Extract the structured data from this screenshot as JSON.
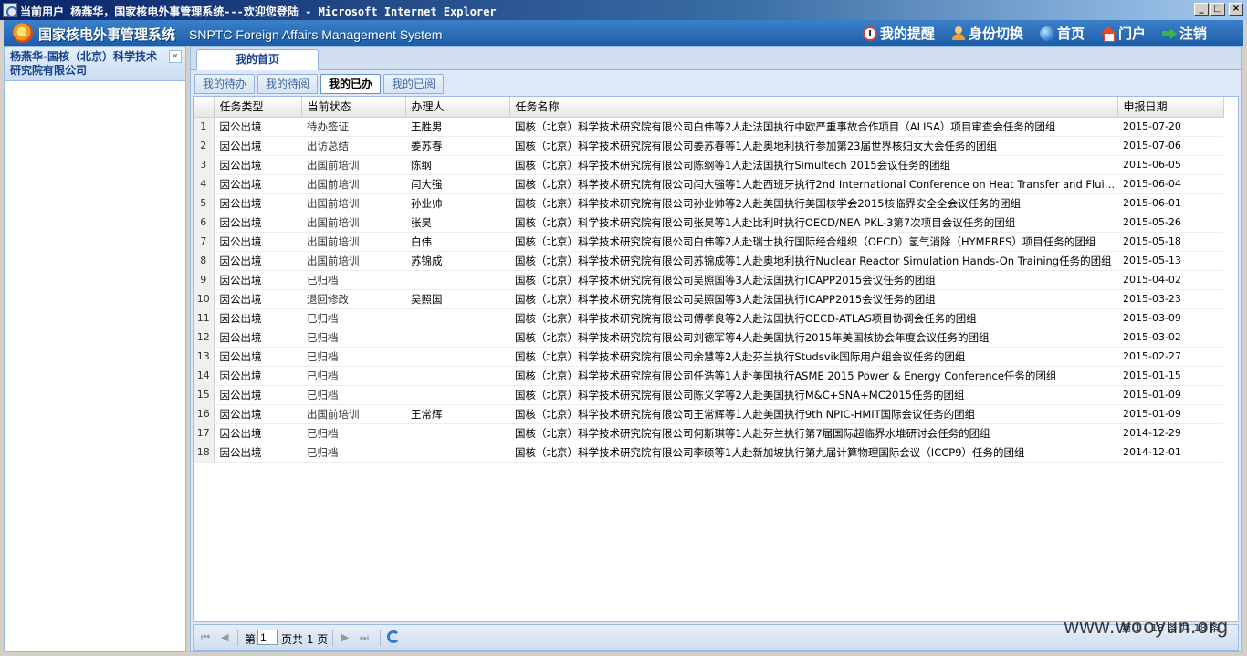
{
  "window": {
    "title": "当前用户 杨燕华，国家核电外事管理系统---欢迎您登陆 - Microsoft Internet Explorer"
  },
  "header": {
    "system_name_cn": "国家核电外事管理系统",
    "system_name_en": "SNPTC Foreign Affairs Management System",
    "nav": [
      {
        "label": "我的提醒",
        "icon": "clock-icon"
      },
      {
        "label": "身份切换",
        "icon": "user-icon"
      },
      {
        "label": "首页",
        "icon": "globe-icon"
      },
      {
        "label": "门户",
        "icon": "house-icon"
      },
      {
        "label": "注销",
        "icon": "logout-icon"
      }
    ]
  },
  "sidebar": {
    "user": "杨燕华-国核（北京）科学技术研究院有限公司",
    "collapse_glyph": "«"
  },
  "main": {
    "tab": "我的首页",
    "subtabs": [
      {
        "label": "我的待办",
        "active": false
      },
      {
        "label": "我的待阅",
        "active": false
      },
      {
        "label": "我的已办",
        "active": true
      },
      {
        "label": "我的已阅",
        "active": false
      }
    ],
    "columns": [
      "任务类型",
      "当前状态",
      "办理人",
      "任务名称",
      "申报日期"
    ],
    "rows": [
      {
        "n": "1",
        "type": "因公出境",
        "status": "待办签证",
        "handler": "王胜男",
        "name": "国核（北京）科学技术研究院有限公司白伟等2人赴法国执行中欧严重事故合作项目（ALISA）项目审查会任务的团组",
        "date": "2015-07-20"
      },
      {
        "n": "2",
        "type": "因公出境",
        "status": "出访总结",
        "handler": "姜苏春",
        "name": "国核（北京）科学技术研究院有限公司姜苏春等1人赴奥地利执行参加第23届世界核妇女大会任务的团组",
        "date": "2015-07-06"
      },
      {
        "n": "3",
        "type": "因公出境",
        "status": "出国前培训",
        "handler": "陈纲",
        "name": "国核（北京）科学技术研究院有限公司陈纲等1人赴法国执行Simultech 2015会议任务的团组",
        "date": "2015-06-05"
      },
      {
        "n": "4",
        "type": "因公出境",
        "status": "出国前培训",
        "handler": "闫大强",
        "name": "国核（北京）科学技术研究院有限公司闫大强等1人赴西班牙执行2nd International Conference on Heat Transfer and Fluid Flow任务的团组",
        "date": "2015-06-04"
      },
      {
        "n": "5",
        "type": "因公出境",
        "status": "出国前培训",
        "handler": "孙业帅",
        "name": "国核（北京）科学技术研究院有限公司孙业帅等2人赴美国执行美国核学会2015核临界安全全会议任务的团组",
        "date": "2015-06-01"
      },
      {
        "n": "6",
        "type": "因公出境",
        "status": "出国前培训",
        "handler": "张昊",
        "name": "国核（北京）科学技术研究院有限公司张昊等1人赴比利时执行OECD/NEA PKL-3第7次项目会议任务的团组",
        "date": "2015-05-26"
      },
      {
        "n": "7",
        "type": "因公出境",
        "status": "出国前培训",
        "handler": "白伟",
        "name": "国核（北京）科学技术研究院有限公司白伟等2人赴瑞士执行国际经合组织（OECD）氢气消除（HYMERES）项目任务的团组",
        "date": "2015-05-18"
      },
      {
        "n": "8",
        "type": "因公出境",
        "status": "出国前培训",
        "handler": "苏锦成",
        "name": "国核（北京）科学技术研究院有限公司苏锦成等1人赴奥地利执行Nuclear Reactor Simulation Hands-On Training任务的团组",
        "date": "2015-05-13"
      },
      {
        "n": "9",
        "type": "因公出境",
        "status": "已归档",
        "handler": "",
        "name": "国核（北京）科学技术研究院有限公司吴照国等3人赴法国执行ICAPP2015会议任务的团组",
        "date": "2015-04-02"
      },
      {
        "n": "10",
        "type": "因公出境",
        "status": "退回修改",
        "handler": "吴照国",
        "name": "国核（北京）科学技术研究院有限公司吴照国等3人赴法国执行ICAPP2015会议任务的团组",
        "date": "2015-03-23"
      },
      {
        "n": "11",
        "type": "因公出境",
        "status": "已归档",
        "handler": "",
        "name": "国核（北京）科学技术研究院有限公司傅孝良等2人赴法国执行OECD-ATLAS项目协调会任务的团组",
        "date": "2015-03-09"
      },
      {
        "n": "12",
        "type": "因公出境",
        "status": "已归档",
        "handler": "",
        "name": "国核（北京）科学技术研究院有限公司刘德军等4人赴美国执行2015年美国核协会年度会议任务的团组",
        "date": "2015-03-02"
      },
      {
        "n": "13",
        "type": "因公出境",
        "status": "已归档",
        "handler": "",
        "name": "国核（北京）科学技术研究院有限公司余慧等2人赴芬兰执行Studsvik国际用户组会议任务的团组",
        "date": "2015-02-27"
      },
      {
        "n": "14",
        "type": "因公出境",
        "status": "已归档",
        "handler": "",
        "name": "国核（北京）科学技术研究院有限公司任浩等1人赴美国执行ASME 2015 Power & Energy Conference任务的团组",
        "date": "2015-01-15"
      },
      {
        "n": "15",
        "type": "因公出境",
        "status": "已归档",
        "handler": "",
        "name": "国核（北京）科学技术研究院有限公司陈义学等2人赴美国执行M&C+SNA+MC2015任务的团组",
        "date": "2015-01-09"
      },
      {
        "n": "16",
        "type": "因公出境",
        "status": "出国前培训",
        "handler": "王常辉",
        "name": "国核（北京）科学技术研究院有限公司王常辉等1人赴美国执行9th NPIC-HMIT国际会议任务的团组",
        "date": "2015-01-09"
      },
      {
        "n": "17",
        "type": "因公出境",
        "status": "已归档",
        "handler": "",
        "name": "国核（北京）科学技术研究院有限公司何斯琪等1人赴芬兰执行第7届国际超临界水堆研讨会任务的团组",
        "date": "2014-12-29"
      },
      {
        "n": "18",
        "type": "因公出境",
        "status": "已归档",
        "handler": "",
        "name": "国核（北京）科学技术研究院有限公司李硕等1人赴新加坡执行第九届计算物理国际会议（ICCP9）任务的团组",
        "date": "2014-12-01"
      }
    ]
  },
  "pager": {
    "first": "⏮",
    "prev": "◀",
    "page_prefix": "第",
    "page_value": "1",
    "page_suffix": "页共 1 页",
    "next": "▶",
    "last": "⏭",
    "status_text": "第 1 - 18 条 共 18 条"
  },
  "watermark": "www.wooyun.org"
}
